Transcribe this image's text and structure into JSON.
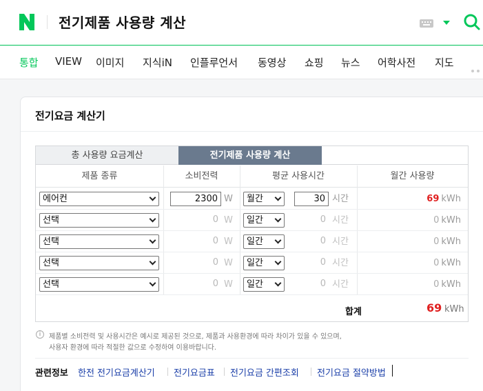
{
  "header": {
    "query": "전기제품 사용량 계산"
  },
  "tabs": [
    "통합",
    "VIEW",
    "이미지",
    "지식iN",
    "인플루언서",
    "동영상",
    "쇼핑",
    "뉴스",
    "어학사전",
    "지도"
  ],
  "card": {
    "title": "전기요금 계산기",
    "calc_tabs": [
      "총 사용량 요금계산",
      "전기제품 사용량 계산"
    ],
    "columns": [
      "제품 종류",
      "소비전력",
      "평균 사용시간",
      "월간 사용량"
    ],
    "rows": [
      {
        "product": "에어컨",
        "power": "2300",
        "period": "월간",
        "hours": "30",
        "usage": "69"
      },
      {
        "product": "선택",
        "power": "0",
        "period": "일간",
        "hours": "0",
        "usage": "0"
      },
      {
        "product": "선택",
        "power": "0",
        "period": "일간",
        "hours": "0",
        "usage": "0"
      },
      {
        "product": "선택",
        "power": "0",
        "period": "일간",
        "hours": "0",
        "usage": "0"
      },
      {
        "product": "선택",
        "power": "0",
        "period": "일간",
        "hours": "0",
        "usage": "0"
      }
    ],
    "unit_w": "W",
    "unit_hour": "시간",
    "unit_kwh": "kWh",
    "total_label": "합계",
    "total_value": "69",
    "notes": [
      "제품별 소비전력 및 사용시간은 예시로 제공된 것으로, 제품과 사용환경에 따라 차이가 있을 수 있으며,",
      "사용자 환경에 따라 적절한 값으로 수정하여 이용바랍니다."
    ],
    "related_label": "관련정보",
    "related_links": [
      "한전 전기요금계산기",
      "전기요금표",
      "전기요금 간편조회",
      "전기요금 절약방법"
    ]
  },
  "colors": {
    "accent": "#03c75a",
    "active_tab": "#6a7a8e",
    "highlight": "#e02020",
    "link": "#1a3ea8"
  }
}
